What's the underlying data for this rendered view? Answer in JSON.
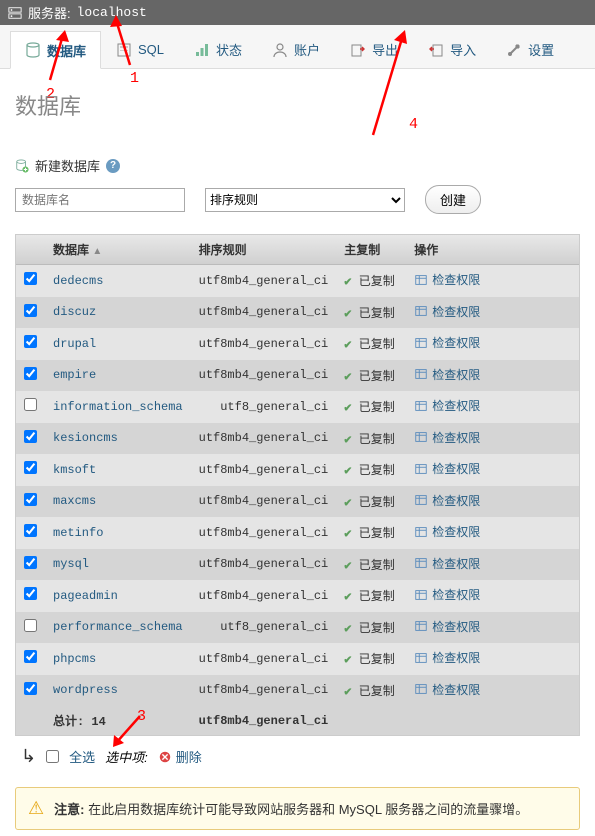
{
  "server_bar": {
    "label": "服务器:",
    "name": "localhost"
  },
  "tabs": {
    "database": "数据库",
    "sql": "SQL",
    "status": "状态",
    "accounts": "账户",
    "export": "导出",
    "import": "导入",
    "settings": "设置"
  },
  "page_title": "数据库",
  "create": {
    "header": "新建数据库",
    "name_placeholder": "数据库名",
    "collation_placeholder": "排序规则",
    "button": "创建"
  },
  "headers": {
    "database": "数据库",
    "collation": "排序规则",
    "master_replication": "主复制",
    "action": "操作"
  },
  "row_labels": {
    "replicated": "已复制",
    "check_privileges": "检查权限"
  },
  "databases": [
    {
      "name": "dedecms",
      "collation": "utf8mb4_general_ci",
      "checked": true
    },
    {
      "name": "discuz",
      "collation": "utf8mb4_general_ci",
      "checked": true
    },
    {
      "name": "drupal",
      "collation": "utf8mb4_general_ci",
      "checked": true
    },
    {
      "name": "empire",
      "collation": "utf8mb4_general_ci",
      "checked": true
    },
    {
      "name": "information_schema",
      "collation": "utf8_general_ci",
      "checked": false
    },
    {
      "name": "kesioncms",
      "collation": "utf8mb4_general_ci",
      "checked": true
    },
    {
      "name": "kmsoft",
      "collation": "utf8mb4_general_ci",
      "checked": true
    },
    {
      "name": "maxcms",
      "collation": "utf8mb4_general_ci",
      "checked": true
    },
    {
      "name": "metinfo",
      "collation": "utf8mb4_general_ci",
      "checked": true
    },
    {
      "name": "mysql",
      "collation": "utf8mb4_general_ci",
      "checked": true
    },
    {
      "name": "pageadmin",
      "collation": "utf8mb4_general_ci",
      "checked": true
    },
    {
      "name": "performance_schema",
      "collation": "utf8_general_ci",
      "checked": false
    },
    {
      "name": "phpcms",
      "collation": "utf8mb4_general_ci",
      "checked": true
    },
    {
      "name": "wordpress",
      "collation": "utf8mb4_general_ci",
      "checked": true
    }
  ],
  "totals": {
    "label": "总计:",
    "count": "14",
    "collation": "utf8mb4_general_ci"
  },
  "bulk": {
    "select_all": "全选",
    "selected_label": "选中项:",
    "delete": "删除"
  },
  "warning": {
    "bold_prefix": "注意:",
    "text": "在此启用数据库统计可能导致网站服务器和 MySQL 服务器之间的流量骤增。"
  },
  "annotations": {
    "a1": "1",
    "a2": "2",
    "a3": "3",
    "a4": "4"
  }
}
